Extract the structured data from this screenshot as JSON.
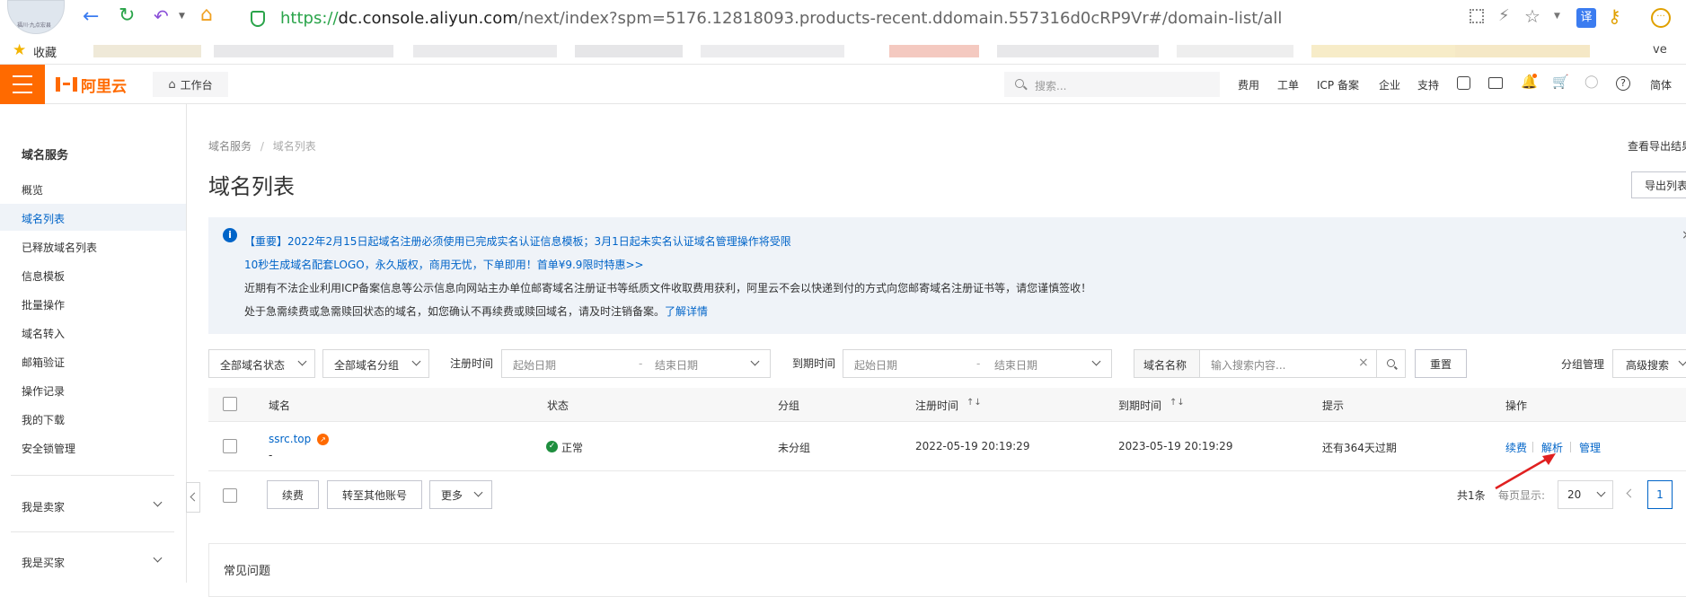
{
  "browser": {
    "url_secure": "https://",
    "url_host": "dc.console.aliyun.com",
    "url_path": "/next/index?spm=5176.12818093.products-recent.ddomain.557316d0cRP9Vr#/domain-list/all",
    "translate_label": "译",
    "more_label": "···",
    "avatar_text": "福川·九点宏县"
  },
  "bookmarks": {
    "favorites_label": "收藏",
    "trailing_text": "ve"
  },
  "header": {
    "logo_text": "阿里云",
    "workbench_label": "工作台",
    "search_placeholder": "搜索...",
    "nav": [
      "费用",
      "工单",
      "ICP 备案",
      "企业",
      "支持"
    ],
    "lang_label": "简体"
  },
  "sidebar": {
    "title": "域名服务",
    "items": [
      "概览",
      "域名列表",
      "已释放域名列表",
      "信息模板",
      "批量操作",
      "域名转入",
      "邮箱验证",
      "操作记录",
      "我的下载",
      "安全锁管理"
    ],
    "groups": [
      "我是卖家",
      "我是买家"
    ]
  },
  "breadcrumb": [
    "域名服务",
    "域名列表"
  ],
  "page_title": "域名列表",
  "top_right": {
    "export_results_label": "查看导出结果",
    "export_list_label": "导出列表"
  },
  "notice": {
    "line1": "【重要】2022年2月15日起域名注册必须使用已完成实名认证信息模板；3月1日起未实名认证域名管理操作将受限",
    "line2": "10秒生成域名配套LOGO，永久版权，商用无忧，下单即用！首单¥9.9限时特惠>>",
    "line3": "近期有不法企业利用ICP备案信息等公示信息向网站主办单位邮寄域名注册证书等纸质文件收取费用获利，阿里云不会以快递到付的方式向您邮寄域名注册证书等，请您谨慎签收！",
    "line4_text": "处于急需续费或急需赎回状态的域名，如您确认不再续费或赎回域名，请及时注销备案。",
    "line4_link": "了解详情",
    "close_label": "×"
  },
  "filters": {
    "status_select": "全部域名状态",
    "group_select": "全部域名分组",
    "reg_time_label": "注册时间",
    "exp_time_label": "到期时间",
    "start_placeholder": "起始日期",
    "end_placeholder": "结束日期",
    "date_sep": "-",
    "search_field_label": "域名名称",
    "search_placeholder": "输入搜索内容...",
    "reset_label": "重置",
    "group_manage_label": "分组管理",
    "advanced_search_label": "高级搜索"
  },
  "table": {
    "headers": [
      "域名",
      "状态",
      "分组",
      "注册时间",
      "到期时间",
      "提示",
      "操作"
    ],
    "sort_icon": "↑↓",
    "rows": [
      {
        "domain": "ssrc.top",
        "sub": "-",
        "status": "正常",
        "group": "未分组",
        "reg_time": "2022-05-19 20:19:29",
        "exp_time": "2023-05-19 20:19:29",
        "hint": "还有364天过期",
        "actions": [
          "续费",
          "解析",
          "管理"
        ]
      }
    ]
  },
  "footer_bar": {
    "renew_label": "续费",
    "transfer_label": "转至其他账号",
    "more_label": "更多",
    "total_label": "共1条",
    "per_page_label": "每页显示:",
    "per_page_value": "20",
    "current_page": "1"
  },
  "faq_title": "常见问题",
  "colors": {
    "brand_orange": "#ff6a00",
    "link_blue": "#0064c8",
    "notice_bg": "#eff3f8",
    "success_green": "#1e8e3e",
    "arrow_red": "#e02020"
  }
}
